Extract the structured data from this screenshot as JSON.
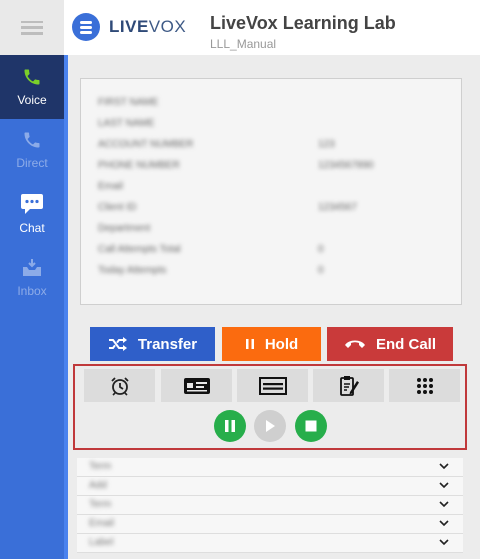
{
  "header": {
    "logo_bold": "LIVE",
    "logo_rest": "VOX",
    "app_title": "LiveVox Learning Lab",
    "app_subtitle": "LLL_Manual"
  },
  "sidebar": {
    "items": [
      {
        "label": "Voice",
        "icon": "phone-icon"
      },
      {
        "label": "Direct",
        "icon": "phone-icon"
      },
      {
        "label": "Chat",
        "icon": "chat-icon"
      },
      {
        "label": "Inbox",
        "icon": "inbox-icon"
      }
    ]
  },
  "details": {
    "rows": [
      {
        "field": "FIRST NAME",
        "value": ""
      },
      {
        "field": "LAST NAME",
        "value": ""
      },
      {
        "field": "ACCOUNT NUMBER",
        "value": "123"
      },
      {
        "field": "PHONE NUMBER",
        "value": "1234567890"
      },
      {
        "field": "Email",
        "value": ""
      },
      {
        "field": "Client ID",
        "value": "1234567"
      },
      {
        "field": "Department",
        "value": ""
      },
      {
        "field": "Call Attempts Total",
        "value": "0"
      },
      {
        "field": "Today Attempts",
        "value": "0"
      }
    ]
  },
  "actions": {
    "transfer": "Transfer",
    "hold": "Hold",
    "end_call": "End Call"
  },
  "tools": [
    {
      "icon": "alarm-clock-icon"
    },
    {
      "icon": "payment-card-icon"
    },
    {
      "icon": "check-icon"
    },
    {
      "icon": "clipboard-edit-icon"
    },
    {
      "icon": "keypad-icon"
    }
  ],
  "media": [
    {
      "icon": "pause-icon",
      "color": "#27ae4b"
    },
    {
      "icon": "play-icon",
      "color": "#cfcfcf"
    },
    {
      "icon": "stop-icon",
      "color": "#27ae4b"
    }
  ],
  "dropdowns": [
    {
      "text": "Term"
    },
    {
      "text": "Add"
    },
    {
      "text": "Term"
    },
    {
      "text": "Email"
    },
    {
      "text": "Label"
    }
  ],
  "colors": {
    "sidebar": "#3a6fd8",
    "sidebar_active": "#1f3569",
    "transfer": "#2f5fc9",
    "hold": "#fb6b0f",
    "end_call": "#c93a3a",
    "highlight_border": "#c0393b"
  }
}
